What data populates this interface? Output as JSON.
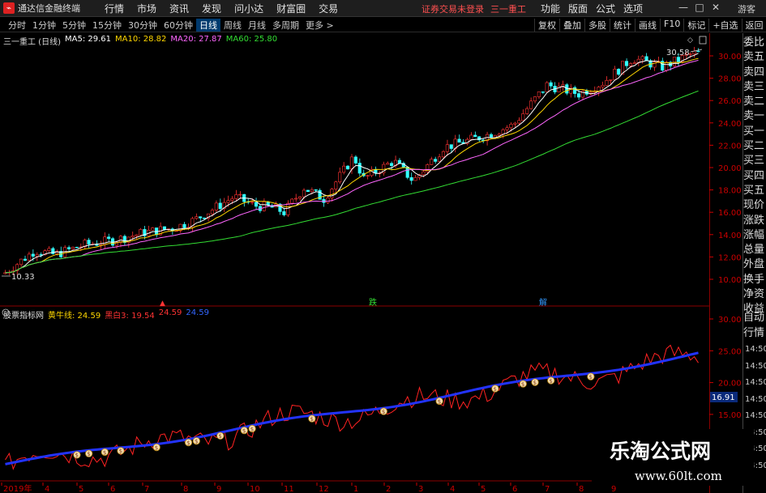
{
  "app": {
    "title": "通达信金融终端",
    "menu_left": [
      "行情",
      "市场",
      "资讯",
      "发现",
      "问小达",
      "财富圈",
      "交易"
    ],
    "status_msg": "证券交易未登录",
    "stock_name": "三一重工",
    "menu_right": [
      "功能",
      "版面",
      "公式",
      "选项"
    ],
    "window_controls": [
      "—",
      "□",
      "✕"
    ],
    "guest_label": "游客"
  },
  "period_bar": {
    "periods": [
      "分时",
      "1分钟",
      "5分钟",
      "15分钟",
      "30分钟",
      "60分钟",
      "日线",
      "周线",
      "月线",
      "多周期",
      "更多 >"
    ],
    "active": "日线",
    "tools": [
      "复权",
      "叠加",
      "多股",
      "统计",
      "画线",
      "F10",
      "标记",
      "+自选",
      "返回"
    ]
  },
  "main_panel": {
    "stock_label": "三一重工 (日线)",
    "ma": [
      {
        "label": "MA5: 29.61",
        "color": "#ffffff"
      },
      {
        "label": "MA10: 28.82",
        "color": "#ffd700"
      },
      {
        "label": "MA20: 27.87",
        "color": "#ff66ff"
      },
      {
        "label": "MA60: 25.80",
        "color": "#33dd33"
      }
    ],
    "y_ticks": [
      "30.00",
      "28.00",
      "26.00",
      "24.00",
      "22.00",
      "20.00",
      "18.00",
      "16.00",
      "14.00",
      "12.00",
      "10.00"
    ],
    "high_label": "30.58",
    "low_label": "10.33",
    "signals": [
      {
        "text": "跌",
        "color": "#33dd33"
      },
      {
        "text": "解",
        "color": "#3399ff"
      }
    ]
  },
  "sub_panel": {
    "indicator": "股票指标网",
    "bull_line": "黄牛线: 24.59",
    "values": [
      {
        "label": "黑白3: 19.54",
        "color": "#ff3333"
      },
      {
        "label": "24.59",
        "color": "#ff3333"
      },
      {
        "label": "24.59",
        "color": "#3366ff"
      }
    ],
    "y_ticks": [
      "30.00",
      "25.00",
      "20.00",
      "15.00"
    ],
    "current_value": "16.91"
  },
  "side_panel": {
    "items": [
      "委比",
      "卖五",
      "卖四",
      "卖三",
      "卖二",
      "卖一",
      "买一",
      "买二",
      "买三",
      "买四",
      "买五",
      "现价",
      "涨跌",
      "涨幅",
      "总量",
      "外盘",
      "换手",
      "净资",
      "收益"
    ],
    "items2": [
      "自动",
      "行情"
    ],
    "times": [
      "14:50",
      "14:50",
      "14:50",
      "14:50",
      "14:50",
      "14:50",
      "14:50",
      "14:50"
    ]
  },
  "date_axis": {
    "labels": [
      "2019年",
      "4",
      "5",
      "6",
      "7",
      "8",
      "9",
      "10",
      "11",
      "12",
      "1",
      "2",
      "3",
      "4",
      "5",
      "6",
      "7",
      "8",
      "9"
    ]
  },
  "watermark": {
    "title": "乐淘公式网",
    "url": "www.60lt.com"
  },
  "colors": {
    "up": "#ff3333",
    "down": "#33ffff",
    "axis": "#c00000",
    "bull_line": "#2233ff"
  }
}
